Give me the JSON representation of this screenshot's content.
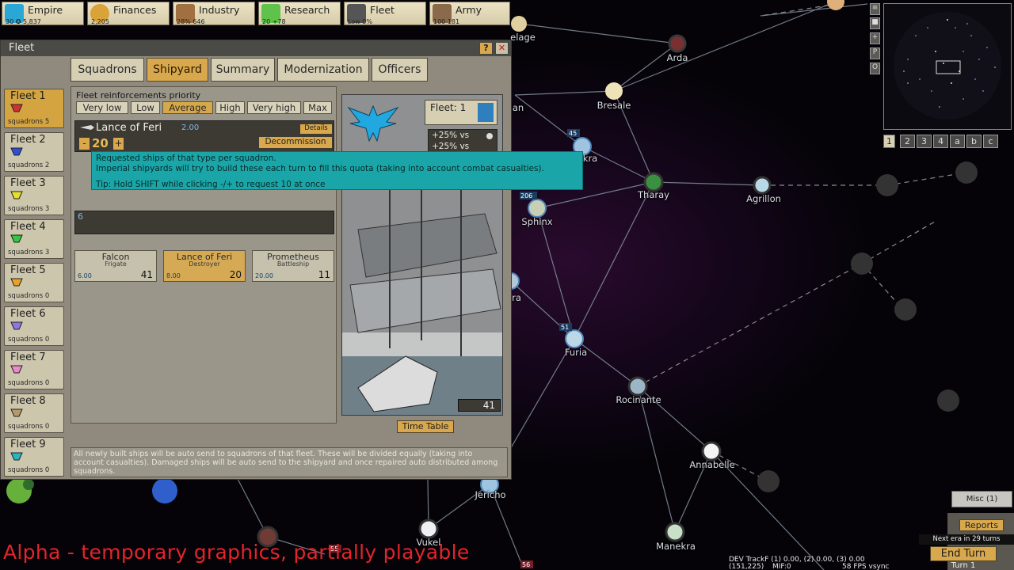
{
  "colors": {
    "accent": "#d9a84c",
    "tooltip": "#1aa6a8",
    "alpha_text": "#e3242b"
  },
  "topbar": [
    {
      "label": "Empire",
      "icon": "eagle-icon",
      "stats": "30 ✪ 5,837"
    },
    {
      "label": "Finances",
      "icon": "coin-icon",
      "stats": "2,205"
    },
    {
      "label": "Industry",
      "icon": "factory-icon",
      "stats": "28% 646"
    },
    {
      "label": "Research",
      "icon": "flask-icon",
      "stats": "20 +78"
    },
    {
      "label": "Fleet",
      "icon": "ship-icon",
      "stats": "Low 0%"
    },
    {
      "label": "Army",
      "icon": "soldier-icon",
      "stats": "100 181"
    }
  ],
  "window": {
    "title": "Fleet",
    "help_label": "?",
    "close_label": "✕"
  },
  "tabs": [
    "Squadrons",
    "Shipyard",
    "Summary",
    "Modernization",
    "Officers"
  ],
  "fleets": [
    {
      "name": "Fleet 1",
      "squadrons": "squadrons 5",
      "color": "#d23030"
    },
    {
      "name": "Fleet 2",
      "squadrons": "squadrons 2",
      "color": "#2f4fd6"
    },
    {
      "name": "Fleet 3",
      "squadrons": "squadrons 3",
      "color": "#e6df2e"
    },
    {
      "name": "Fleet 4",
      "squadrons": "squadrons 3",
      "color": "#33c640"
    },
    {
      "name": "Fleet 5",
      "squadrons": "squadrons 0",
      "color": "#e9a227"
    },
    {
      "name": "Fleet 6",
      "squadrons": "squadrons 0",
      "color": "#8d78e0"
    },
    {
      "name": "Fleet 7",
      "squadrons": "squadrons 0",
      "color": "#e98ac9"
    },
    {
      "name": "Fleet 8",
      "squadrons": "squadrons 0",
      "color": "#b59a69"
    },
    {
      "name": "Fleet 9",
      "squadrons": "squadrons 0",
      "color": "#27b5c4"
    }
  ],
  "shipyard": {
    "priority_label": "Fleet reinforcements priority",
    "priority_options": [
      "Very low",
      "Low",
      "Average",
      "High",
      "Very high",
      "Max"
    ],
    "priority_selected": 2,
    "ship_title": "Lance of Feri",
    "ship_cost": "2.00",
    "details_label": "Details",
    "minus_label": "-",
    "plus_label": "+",
    "quota_value": "20",
    "decommission_label": "Decommission",
    "partial_row_value": "6",
    "fleet_badge": "Fleet: 1",
    "bonuses": [
      "+25% vs",
      "+25% vs"
    ],
    "preview_count": "41",
    "timetable_label": "Time Table",
    "ships": [
      {
        "name": "Falcon",
        "class": "Frigate",
        "cost": "6.00",
        "count": "41"
      },
      {
        "name": "Lance of Feri",
        "class": "Destroyer",
        "cost": "8.00",
        "count": "20"
      },
      {
        "name": "Prometheus",
        "class": "Battleship",
        "cost": "20.00",
        "count": "11"
      }
    ],
    "info": "All newly built ships will be auto send to squadrons of that fleet. These will be divided equally (taking into account casualties). Damaged ships will be auto send to the shipyard and once repaired auto distributed among squadrons."
  },
  "tooltip": {
    "line1": "Requested ships of that type per squadron.",
    "line2": "Imperial shipyards will try to build these each turn to fill this quota (taking into account combat casualties).",
    "line3": "Tip: Hold SHIFT while clicking -/+ to request 10 at once"
  },
  "systems": [
    "elage",
    "Arda",
    "Bresale",
    "Tharay",
    "Agrillon",
    "Sphinx",
    "Furia",
    "Rocinante",
    "Annabelle",
    "Jericho",
    "Vukel",
    "Manekra"
  ],
  "partial_labels": {
    "kra": "kra",
    "an": "an",
    "ra": "ra"
  },
  "system_badges": {
    "b45": "45",
    "b206": "206",
    "b51": "51",
    "b55": "55",
    "b56": "56"
  },
  "minimap": {
    "side_buttons": [
      "≡",
      "■",
      "+",
      "P",
      "O"
    ],
    "tabs": [
      "1",
      "2",
      "3",
      "4",
      "a",
      "b",
      "c"
    ]
  },
  "bottom": {
    "misc_label": "Misc (1)",
    "reports_label": "Reports",
    "next_era": "Next era in 29 turns",
    "end_turn_label": "End Turn",
    "turn": "Turn 1",
    "dev_line1": "DEV TrackF (1) 0.00, (2) 0.00, (3) 0.00",
    "dev_line2": "(151,225)",
    "dev_mif": "MIF:0",
    "dev_fps": "58 FPS vsync",
    "alpha": "Alpha - temporary graphics, partially playable"
  }
}
